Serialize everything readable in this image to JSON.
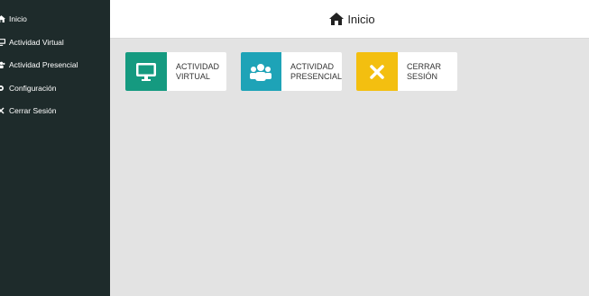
{
  "sidebar": {
    "items": [
      {
        "label": "Inicio",
        "icon": "home-icon"
      },
      {
        "label": "Actividad Virtual",
        "icon": "monitor-icon"
      },
      {
        "label": "Actividad Presencial",
        "icon": "users-icon"
      },
      {
        "label": "Configuración",
        "icon": "gear-icon"
      },
      {
        "label": "Cerrar Sesión",
        "icon": "close-icon"
      }
    ]
  },
  "header": {
    "title": "Inicio",
    "icon": "home-icon"
  },
  "cards": [
    {
      "line1": "ACTIVIDAD",
      "line2": "VIRTUAL",
      "color": "#159a80",
      "icon": "monitor-icon"
    },
    {
      "line1": "ACTIVIDAD",
      "line2": "PRESENCIAL",
      "color": "#1ea3b7",
      "icon": "users-icon"
    },
    {
      "line1": "CERRAR",
      "line2": "SESIÓN",
      "color": "#f3bf10",
      "icon": "close-icon"
    }
  ],
  "colors": {
    "sidebar_bg": "#1e2b2b",
    "content_bg": "#e3e3e3"
  }
}
